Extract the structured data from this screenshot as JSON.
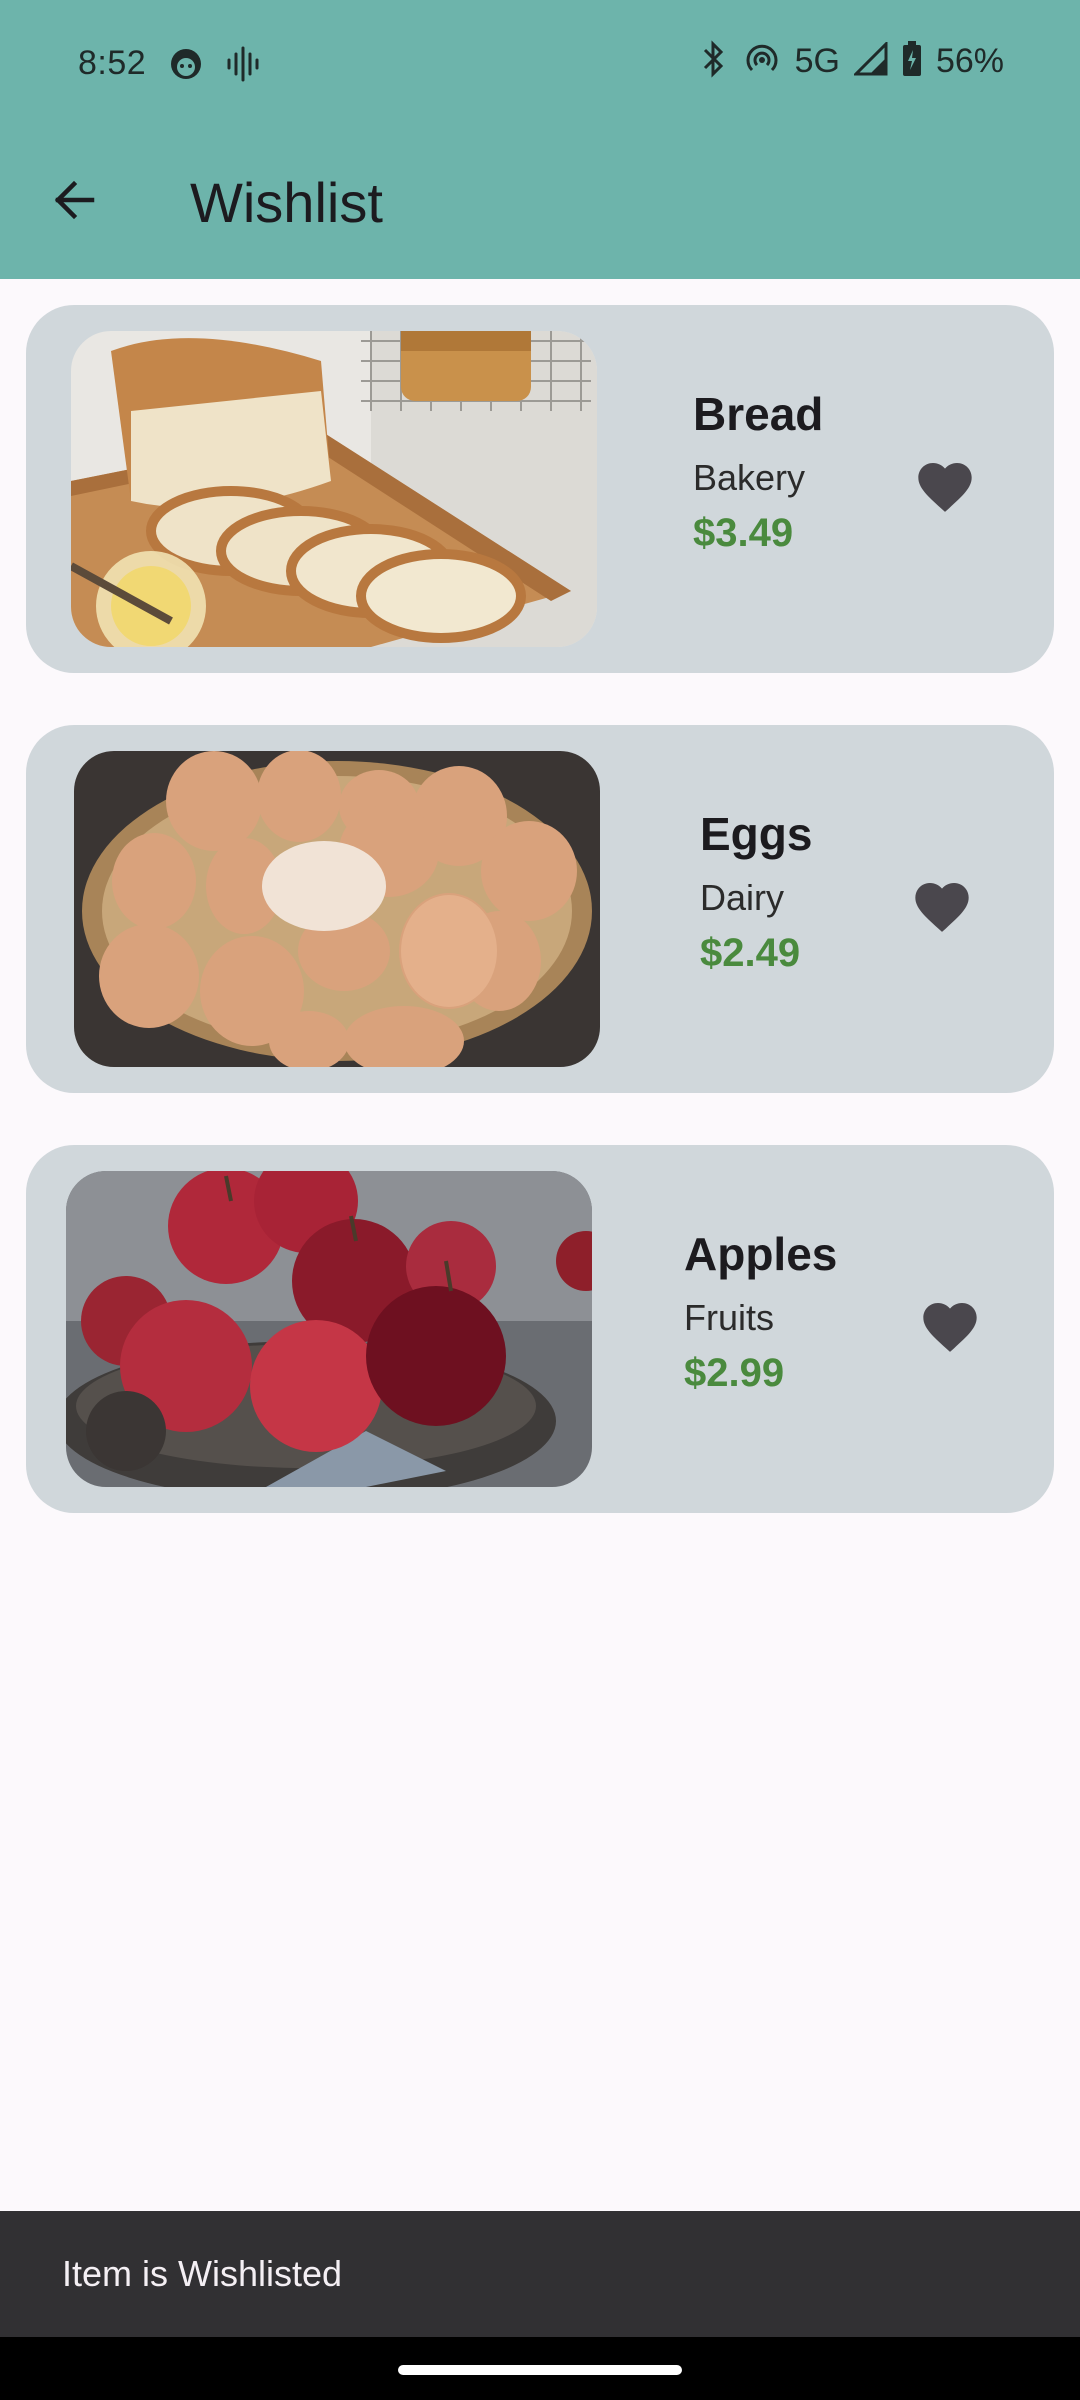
{
  "status_bar": {
    "time": "8:52",
    "network": "5G",
    "battery": "56%"
  },
  "app_bar": {
    "title": "Wishlist"
  },
  "items": [
    {
      "name": "Bread",
      "category": "Bakery",
      "price": "$3.49",
      "favorite_icon": "heart-filled"
    },
    {
      "name": "Eggs",
      "category": "Dairy",
      "price": "$2.49",
      "favorite_icon": "heart-filled"
    },
    {
      "name": "Apples",
      "category": "Fruits",
      "price": "$2.99",
      "favorite_icon": "heart-filled"
    }
  ],
  "snackbar": {
    "message": "Item is Wishlisted"
  },
  "colors": {
    "app_bar": "#6db4ab",
    "card": "#d0d7db",
    "price": "#4a8a3e",
    "snackbar": "#313033"
  }
}
